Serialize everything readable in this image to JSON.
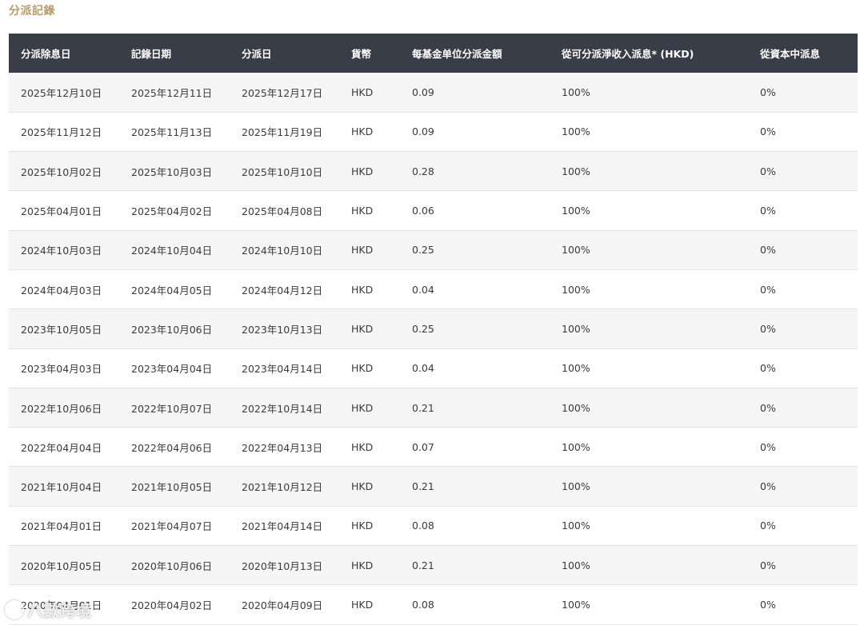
{
  "section_title": "分派記錄",
  "table": {
    "headers": [
      "分派除息日",
      "記錄日期",
      "分派日",
      "貨幣",
      "每基金单位分派金額",
      "從可分派淨收入派息* (HKD)",
      "從資本中派息"
    ],
    "rows": [
      [
        "2025年12月10日",
        "2025年12月11日",
        "2025年12月17日",
        "HKD",
        "0.09",
        "100%",
        "0%"
      ],
      [
        "2025年11月12日",
        "2025年11月13日",
        "2025年11月19日",
        "HKD",
        "0.09",
        "100%",
        "0%"
      ],
      [
        "2025年10月02日",
        "2025年10月03日",
        "2025年10月10日",
        "HKD",
        "0.28",
        "100%",
        "0%"
      ],
      [
        "2025年04月01日",
        "2025年04月02日",
        "2025年04月08日",
        "HKD",
        "0.06",
        "100%",
        "0%"
      ],
      [
        "2024年10月03日",
        "2024年10月04日",
        "2024年10月10日",
        "HKD",
        "0.25",
        "100%",
        "0%"
      ],
      [
        "2024年04月03日",
        "2024年04月05日",
        "2024年04月12日",
        "HKD",
        "0.04",
        "100%",
        "0%"
      ],
      [
        "2023年10月05日",
        "2023年10月06日",
        "2023年10月13日",
        "HKD",
        "0.25",
        "100%",
        "0%"
      ],
      [
        "2023年04月03日",
        "2023年04月04日",
        "2023年04月14日",
        "HKD",
        "0.04",
        "100%",
        "0%"
      ],
      [
        "2022年10月06日",
        "2022年10月07日",
        "2022年10月14日",
        "HKD",
        "0.21",
        "100%",
        "0%"
      ],
      [
        "2022年04月04日",
        "2022年04月06日",
        "2022年04月13日",
        "HKD",
        "0.07",
        "100%",
        "0%"
      ],
      [
        "2021年10月04日",
        "2021年10月05日",
        "2021年10月12日",
        "HKD",
        "0.21",
        "100%",
        "0%"
      ],
      [
        "2021年04月01日",
        "2021年04月07日",
        "2021年04月14日",
        "HKD",
        "0.08",
        "100%",
        "0%"
      ],
      [
        "2020年10月05日",
        "2020年10月06日",
        "2020年10月13日",
        "HKD",
        "0.21",
        "100%",
        "0%"
      ],
      [
        "2020年04月01日",
        "2020年04月02日",
        "2020年04月09日",
        "HKD",
        "0.08",
        "100%",
        "0%"
      ]
    ]
  },
  "watermark": {
    "text": "八數跨境"
  },
  "colors": {
    "title": "#b89a6a",
    "header_bg": "#393d47",
    "header_text": "#ffffff",
    "row_alt_bg": "#f5f5f5",
    "row_bg": "#ffffff",
    "cell_text": "#3a3a3a"
  }
}
